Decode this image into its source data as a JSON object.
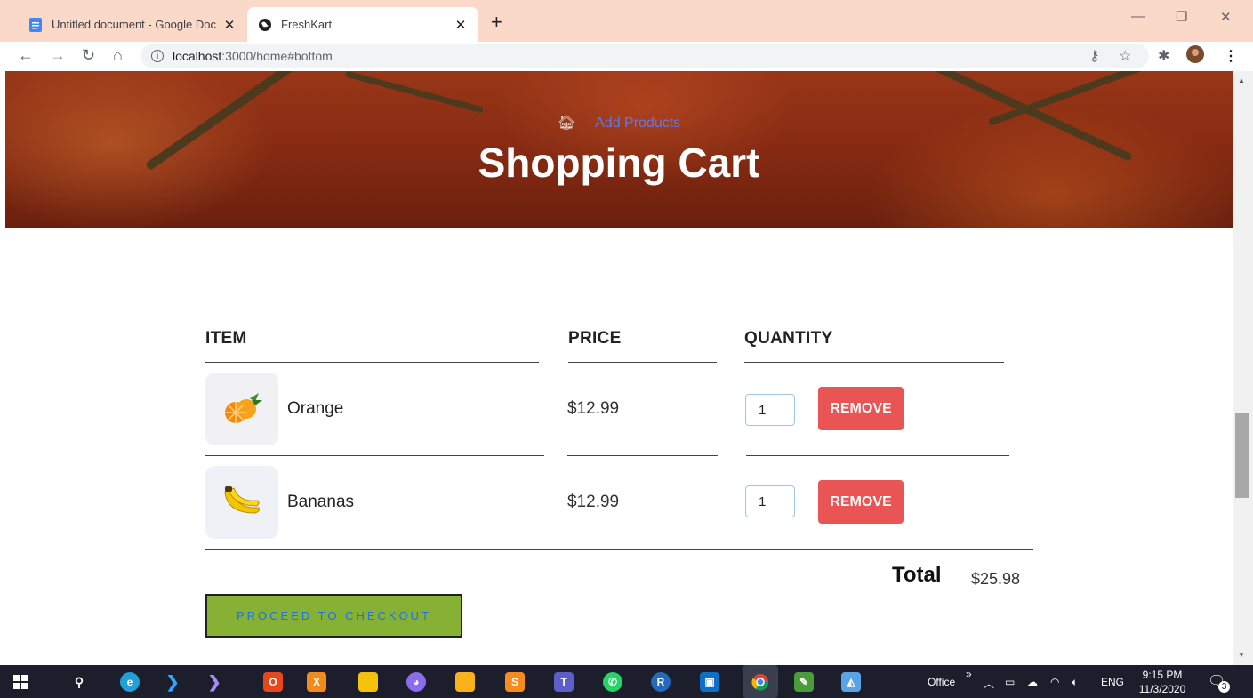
{
  "browser": {
    "tabs": [
      {
        "title": "Untitled document - Google Doc",
        "active": false
      },
      {
        "title": "FreshKart",
        "active": true
      }
    ],
    "url_host": "localhost",
    "url_rest": ":3000/home#bottom",
    "new_tab": "+",
    "close_glyph": "✕"
  },
  "hero": {
    "breadcrumb_link": "Add Products",
    "title": "Shopping Cart"
  },
  "cart": {
    "headers": {
      "item": "ITEM",
      "price": "PRICE",
      "quantity": "QUANTITY"
    },
    "items": [
      {
        "name": "Orange",
        "price": "$12.99",
        "quantity": "1",
        "remove_label": "REMOVE",
        "icon": "orange-icon"
      },
      {
        "name": "Bananas",
        "price": "$12.99",
        "quantity": "1",
        "remove_label": "REMOVE",
        "icon": "bananas-icon"
      }
    ],
    "total_label": "Total",
    "total_value": "$25.98",
    "checkout_label": "PROCEED TO CHECKOUT"
  },
  "taskbar": {
    "office_label": "Office",
    "language": "ENG",
    "time": "9:15 PM",
    "date": "11/3/2020",
    "notifications": "3"
  },
  "colors": {
    "remove_button": "#e95454",
    "checkout_button": "#86b135",
    "checkout_text": "#1a73e8",
    "tab_strip": "#fbd9c9"
  }
}
